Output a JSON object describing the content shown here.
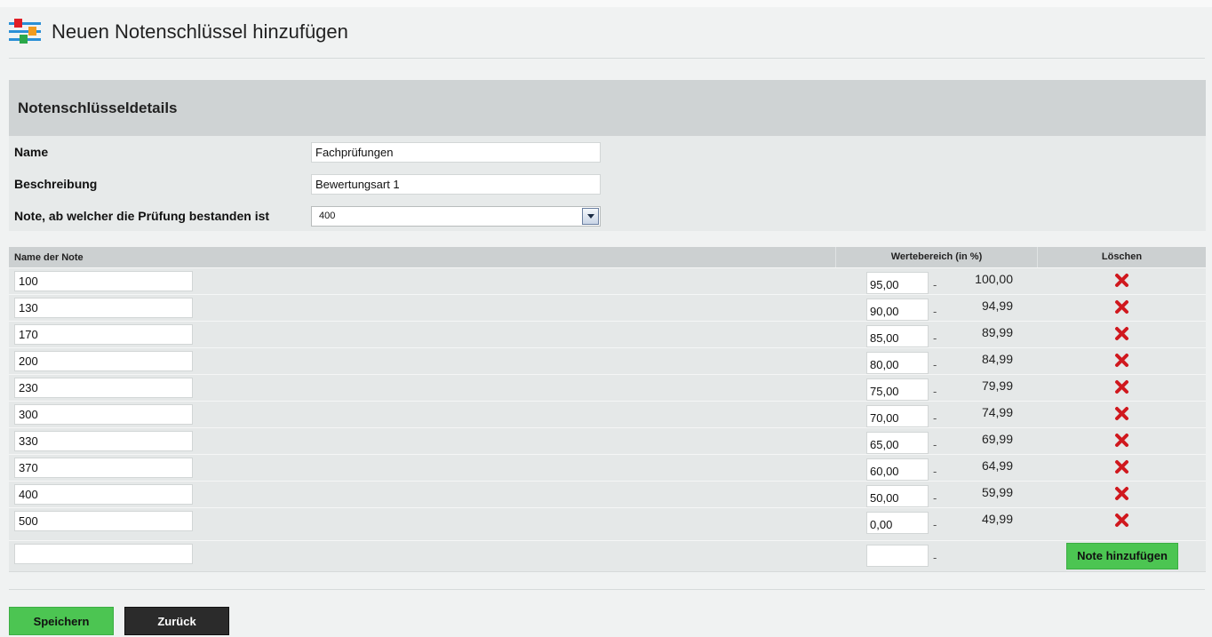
{
  "header": {
    "title": "Neuen Notenschlüssel hinzufügen",
    "icon": "sliders-icon"
  },
  "details": {
    "heading": "Notenschlüsseldetails",
    "name_label": "Name",
    "name_value": "Fachprüfungen",
    "desc_label": "Beschreibung",
    "desc_value": "Bewertungsart 1",
    "pass_label": "Note, ab welcher die Prüfung bestanden ist",
    "pass_value": "400"
  },
  "grades": {
    "col_name": "Name der Note",
    "col_range": "Wertebereich (in %)",
    "col_delete": "Löschen",
    "dash": "-",
    "rows": [
      {
        "name": "100",
        "from": "95,00",
        "to": "100,00"
      },
      {
        "name": "130",
        "from": "90,00",
        "to": "94,99"
      },
      {
        "name": "170",
        "from": "85,00",
        "to": "89,99"
      },
      {
        "name": "200",
        "from": "80,00",
        "to": "84,99"
      },
      {
        "name": "230",
        "from": "75,00",
        "to": "79,99"
      },
      {
        "name": "300",
        "from": "70,00",
        "to": "74,99"
      },
      {
        "name": "330",
        "from": "65,00",
        "to": "69,99"
      },
      {
        "name": "370",
        "from": "60,00",
        "to": "64,99"
      },
      {
        "name": "400",
        "from": "50,00",
        "to": "59,99"
      },
      {
        "name": "500",
        "from": "0,00",
        "to": "49,99"
      }
    ],
    "new_row": {
      "name": "",
      "from": "",
      "add_label": "Note hinzufügen"
    }
  },
  "actions": {
    "save_label": "Speichern",
    "back_label": "Zurück"
  },
  "colors": {
    "accent_green": "#4cc552",
    "delete_red": "#d0181e",
    "dark_button": "#2b2b2b"
  }
}
